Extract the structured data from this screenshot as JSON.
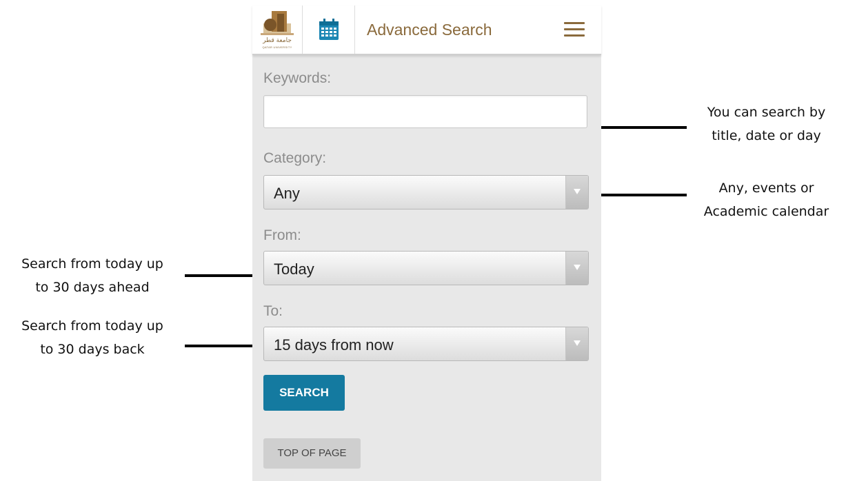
{
  "header": {
    "logo_arabic": "جامعة قطر",
    "logo_english": "QATAR UNIVERSITY",
    "title": "Advanced Search"
  },
  "form": {
    "keywords_label": "Keywords:",
    "keywords_value": "",
    "category_label": "Category:",
    "category_value": "Any",
    "from_label": "From:",
    "from_value": "Today",
    "to_label": "To:",
    "to_value": "15 days from now",
    "search_button": "SEARCH",
    "top_button": "TOP OF PAGE"
  },
  "annotations": {
    "keywords_line1": "You can search by",
    "keywords_line2": "title, date or day",
    "category_line1": "Any, events or",
    "category_line2": "Academic calendar",
    "from_line1": "Search from today up",
    "from_line2": "to 30 days ahead",
    "to_line1": "Search from today up",
    "to_line2": "to 30 days back"
  },
  "colors": {
    "accent_brown": "#8a6a3c",
    "button_blue": "#147aa0",
    "panel_bg": "#e8e8e8"
  },
  "icons": [
    "qatar-university-logo",
    "calendar-icon",
    "hamburger-menu-icon",
    "dropdown-arrow-icon"
  ]
}
